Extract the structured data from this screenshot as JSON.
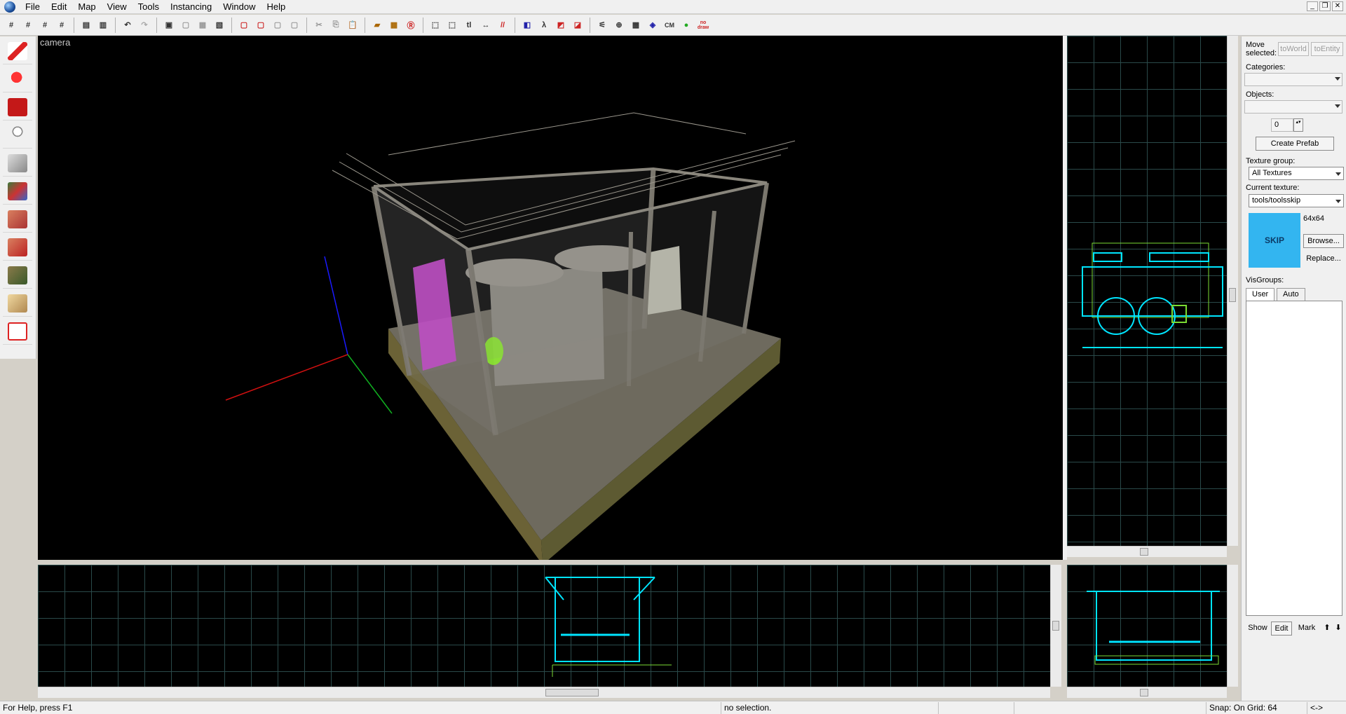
{
  "menu": {
    "items": [
      "File",
      "Edit",
      "Map",
      "View",
      "Tools",
      "Instancing",
      "Window",
      "Help"
    ],
    "window_controls": [
      "_",
      "❐",
      "✕"
    ]
  },
  "toolbar": {
    "cm_label": "CM",
    "nodraw_label": "no draw"
  },
  "camera_view": {
    "label": "camera"
  },
  "right_panel": {
    "move_selected_label": "Move selected:",
    "to_world_label": "toWorld",
    "to_entity_label": "toEntity",
    "categories_label": "Categories:",
    "objects_label": "Objects:",
    "spinner_value": "0",
    "create_prefab_label": "Create Prefab",
    "texture_group_label": "Texture group:",
    "texture_group_value": "All Textures",
    "current_texture_label": "Current texture:",
    "current_texture_value": "tools/toolsskip",
    "texture_preview_text": "SKIP",
    "texture_size": "64x64",
    "browse_label": "Browse...",
    "replace_label": "Replace...",
    "visgroups_label": "VisGroups:",
    "tab_user": "User",
    "tab_auto": "Auto",
    "show_label": "Show",
    "edit_label": "Edit",
    "mark_label": "Mark",
    "up_label": "⬆",
    "down_label": "⬇"
  },
  "status": {
    "help": "For Help, press F1",
    "selection": "no selection.",
    "snap": "Snap: On Grid: 64",
    "nav": "<->"
  },
  "colors": {
    "wireframe": "#00e5ff",
    "bounds": "#7bdc33",
    "texture_preview": "#33b5f0",
    "purple_entity": "#d03ad8",
    "green_entity": "#8cff1a"
  }
}
